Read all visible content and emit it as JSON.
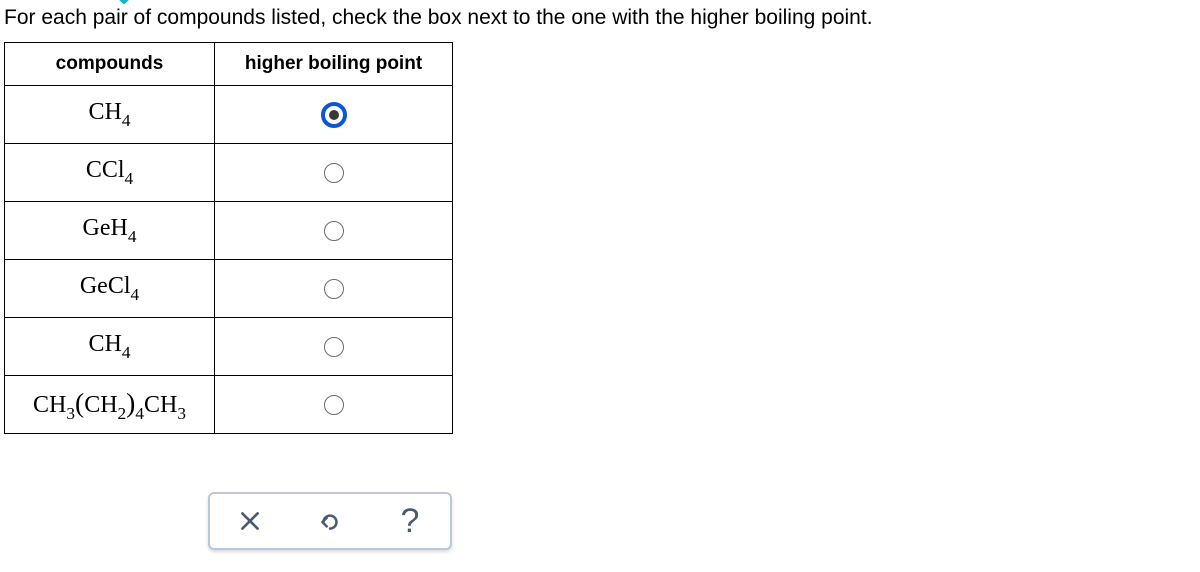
{
  "question": "For each pair of compounds listed, check the box next to the one with the higher boiling point.",
  "headers": {
    "compounds": "compounds",
    "hbp": "higher boiling point"
  },
  "pairs": [
    {
      "a": {
        "parts": [
          "CH",
          "4"
        ],
        "selected": true
      },
      "b": {
        "parts": [
          "CCl",
          "4"
        ],
        "selected": false
      }
    },
    {
      "a": {
        "parts": [
          "GeH",
          "4"
        ],
        "selected": false
      },
      "b": {
        "parts": [
          "GeCl",
          "4"
        ],
        "selected": false
      }
    },
    {
      "a": {
        "parts": [
          "CH",
          "4"
        ],
        "selected": false
      },
      "b": {
        "parts": [
          "CH",
          "3",
          "(",
          "CH",
          "2",
          ")",
          "4",
          "CH",
          "3"
        ],
        "selected": false
      }
    }
  ],
  "toolbar": {
    "clear_label": "clear",
    "undo_label": "undo",
    "help_label": "?"
  }
}
